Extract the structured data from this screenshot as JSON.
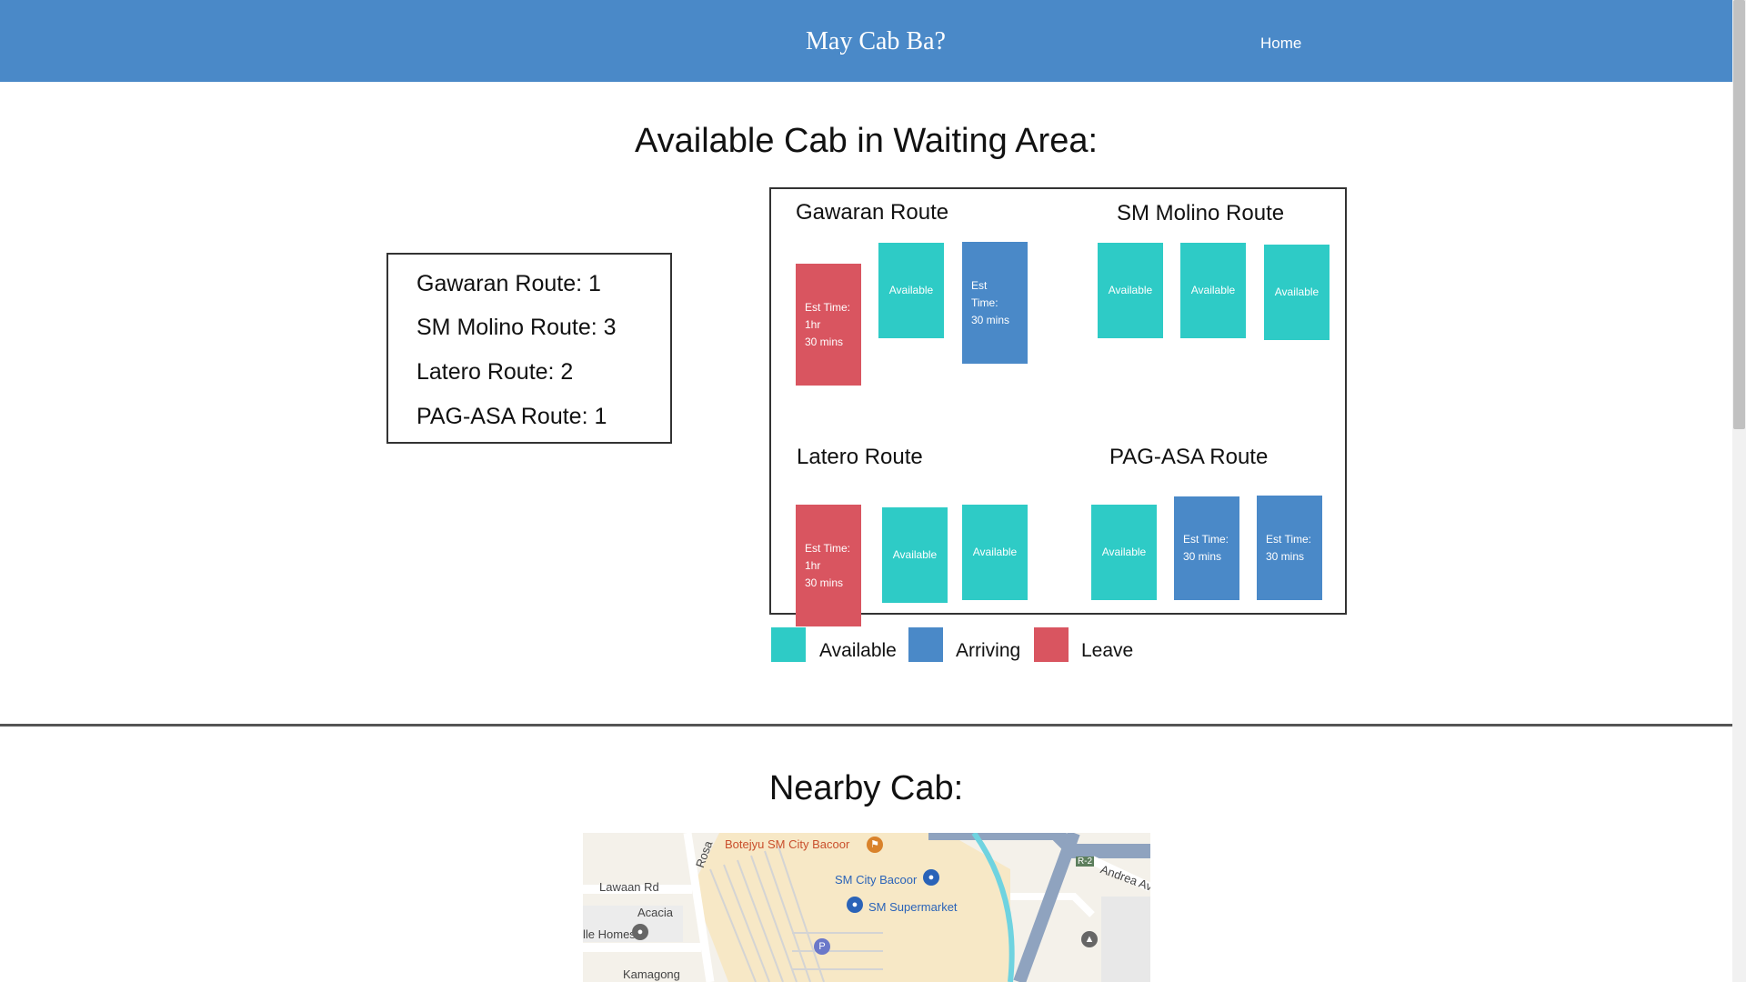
{
  "navbar": {
    "brand": "May Cab Ba?",
    "home_label": "Home"
  },
  "waiting": {
    "title": "Available Cab in Waiting Area:",
    "summary": [
      "Gawaran Route: 1",
      "SM Molino Route: 3",
      "Latero Route: 2",
      "PAG-ASA Route: 1"
    ],
    "routes": [
      {
        "name": "Gawaran Route",
        "cabs": [
          {
            "status": "leave",
            "text": "Est Time:\n1hr\n30 mins"
          },
          {
            "status": "available",
            "text": "Available"
          },
          {
            "status": "arriving",
            "text": "Est\nTime:\n30 mins"
          }
        ]
      },
      {
        "name": "SM Molino Route",
        "cabs": [
          {
            "status": "available",
            "text": "Available"
          },
          {
            "status": "available",
            "text": "Available"
          },
          {
            "status": "available",
            "text": "Available"
          }
        ]
      },
      {
        "name": "Latero Route",
        "cabs": [
          {
            "status": "leave",
            "text": "Est Time:\n1hr\n30 mins"
          },
          {
            "status": "available",
            "text": "Available"
          },
          {
            "status": "available",
            "text": "Available"
          }
        ]
      },
      {
        "name": "PAG-ASA Route",
        "cabs": [
          {
            "status": "available",
            "text": "Available"
          },
          {
            "status": "arriving",
            "text": "Est Time:\n30 mins"
          },
          {
            "status": "arriving",
            "text": "Est Time:\n30 mins"
          }
        ]
      }
    ],
    "legend": [
      {
        "label": "Available",
        "color": "#2ecbc6"
      },
      {
        "label": "Arriving",
        "color": "#4a89c8"
      },
      {
        "label": "Leave",
        "color": "#d95560"
      }
    ]
  },
  "nearby": {
    "title": "Nearby Cab:",
    "map_labels": {
      "botejyu": "Botejyu SM City Bacoor",
      "sm_city": "SM City Bacoor",
      "sm_supermarket": "SM Supermarket",
      "lawaan": "Lawaan Rd",
      "acacia": "Acacia",
      "homes": "lle Homes",
      "kamagong": "Kamagong",
      "rosa": "Rosa",
      "andrea": "Andrea Av",
      "r2": "R-2",
      "parking": "P"
    }
  },
  "colors": {
    "navbar": "#4a89c8",
    "available": "#2ecbc6",
    "arriving": "#4a89c8",
    "leave": "#d95560"
  }
}
